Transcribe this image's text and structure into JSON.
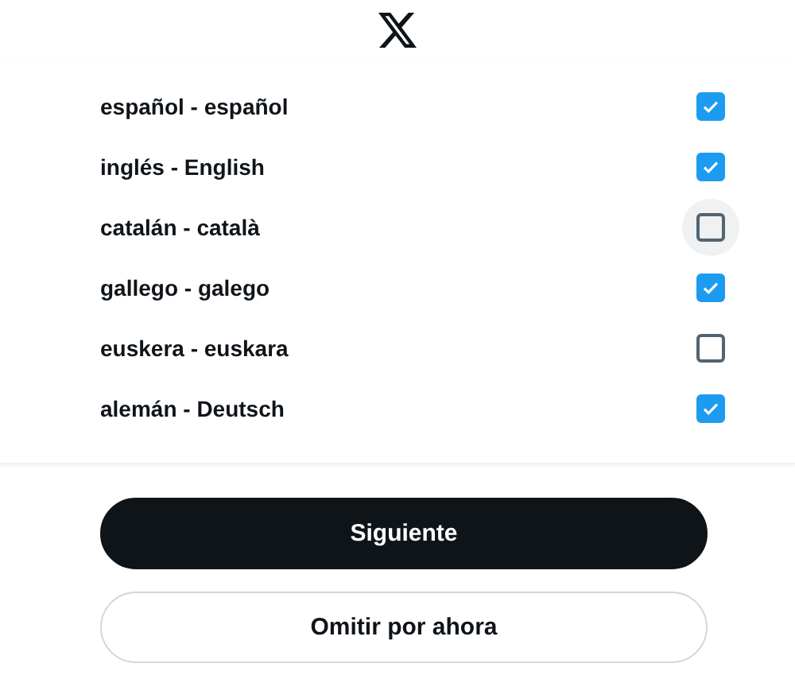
{
  "languages": [
    {
      "label": "español - español",
      "checked": true,
      "hovered": false
    },
    {
      "label": "inglés - English",
      "checked": true,
      "hovered": false
    },
    {
      "label": "catalán - català",
      "checked": false,
      "hovered": true
    },
    {
      "label": "gallego - galego",
      "checked": true,
      "hovered": false
    },
    {
      "label": "euskera - euskara",
      "checked": false,
      "hovered": false
    },
    {
      "label": "alemán - Deutsch",
      "checked": true,
      "hovered": false
    }
  ],
  "buttons": [
    {
      "label": "Siguiente",
      "kind": "primary"
    },
    {
      "label": "Omitir por ahora",
      "kind": "secondary"
    }
  ]
}
